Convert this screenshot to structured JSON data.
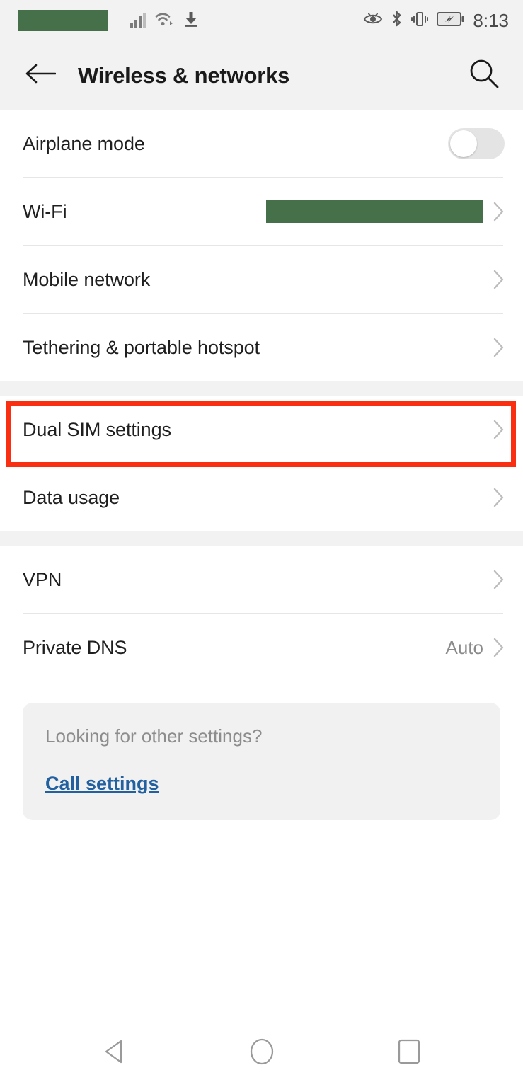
{
  "status_bar": {
    "carrier_redacted": "",
    "icons_left": [
      "signal-bars-icon",
      "wifi-icon",
      "download-icon"
    ],
    "icons_right": [
      "eye-comfort-icon",
      "bluetooth-icon",
      "vibrate-icon",
      "battery-charging-icon"
    ],
    "time": "8:13"
  },
  "app_bar": {
    "back_icon": "back-arrow-icon",
    "title": "Wireless & networks",
    "search_icon": "search-icon"
  },
  "groups": [
    {
      "rows": [
        {
          "label": "Airplane mode",
          "control": "toggle",
          "toggle_on": false
        },
        {
          "label": "Wi-Fi",
          "control": "redacted-value",
          "chevron": true
        },
        {
          "label": "Mobile network",
          "control": "chevron",
          "chevron": true
        },
        {
          "label": "Tethering & portable hotspot",
          "control": "chevron",
          "chevron": true
        }
      ]
    },
    {
      "rows": [
        {
          "label": "Dual SIM settings",
          "control": "chevron",
          "chevron": true,
          "highlighted": true
        },
        {
          "label": "Data usage",
          "control": "chevron",
          "chevron": true
        }
      ]
    },
    {
      "rows": [
        {
          "label": "VPN",
          "control": "chevron",
          "chevron": true
        },
        {
          "label": "Private DNS",
          "control": "value-chevron",
          "value": "Auto",
          "chevron": true
        }
      ]
    }
  ],
  "info_card": {
    "question": "Looking for other settings?",
    "link": "Call settings"
  },
  "nav_bar": {
    "back": "nav-back-triangle-icon",
    "home": "nav-home-circle-icon",
    "recents": "nav-recents-square-icon"
  },
  "colors": {
    "highlight_red": "#fa2e10",
    "redaction_green": "#46704a",
    "link_blue": "#22609f",
    "header_gray": "#f2f2f2",
    "card_gray": "#f1f1f1"
  }
}
